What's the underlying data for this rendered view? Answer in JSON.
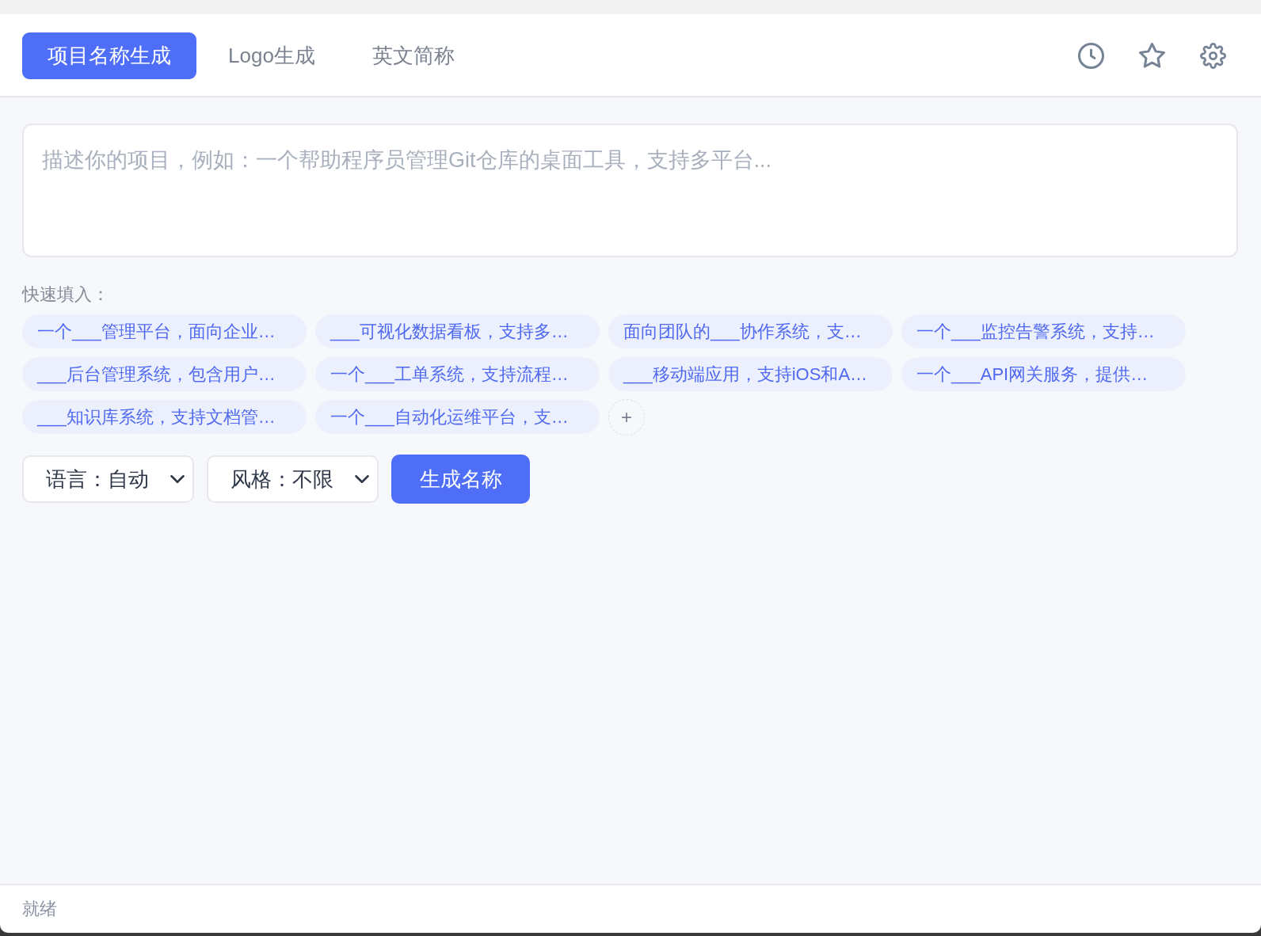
{
  "tabs": [
    {
      "label": "项目名称生成",
      "selected": true
    },
    {
      "label": "Logo生成",
      "selected": false
    },
    {
      "label": "英文简称",
      "selected": false
    }
  ],
  "description": {
    "placeholder": "描述你的项目，例如：一个帮助程序员管理Git仓库的桌面工具，支持多平台..."
  },
  "quick_fill": {
    "label": "快速填入：",
    "templates": [
      "一个___管理平台，面向企业…",
      "___可视化数据看板，支持多…",
      "面向团队的___协作系统，支…",
      "一个___监控告警系统，支持…",
      "___后台管理系统，包含用户…",
      "一个___工单系统，支持流程…",
      "___移动端应用，支持iOS和A…",
      "一个___API网关服务，提供…",
      "___知识库系统，支持文档管…",
      "一个___自动化运维平台，支…"
    ],
    "add_button": "+"
  },
  "options": [
    {
      "value": "语言：自动"
    },
    {
      "value": "风格：不限"
    }
  ],
  "generate_button": "生成名称",
  "status_bar": {
    "text": "就绪"
  }
}
